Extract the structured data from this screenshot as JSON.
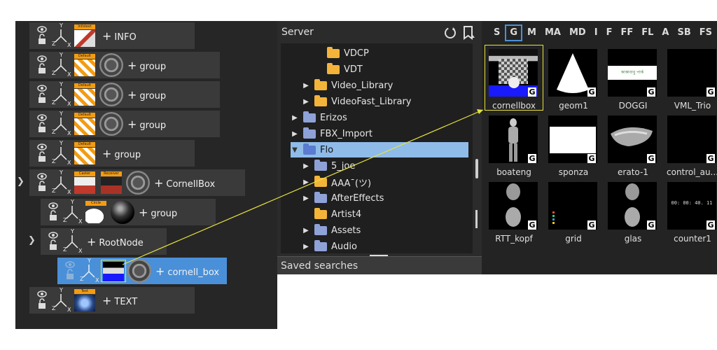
{
  "scene_tree": {
    "nodes": [
      {
        "label": "INFO",
        "tag": "Infotext"
      },
      {
        "label": "group",
        "tag": "Default"
      },
      {
        "label": "group",
        "tag": "Default"
      },
      {
        "label": "group",
        "tag": "Default"
      },
      {
        "label": "group",
        "tag": "Default"
      },
      {
        "label": "CornellBox",
        "tag_caster": "Caster",
        "tag_receiver": "Receiver"
      },
      {
        "label": "group",
        "tag": "Circle"
      },
      {
        "label": "RootNode"
      },
      {
        "label": "cornell_box"
      },
      {
        "label": "TEXT",
        "tag": "Text"
      }
    ],
    "axis": {
      "y": "Y",
      "z": "Z",
      "x": "X"
    }
  },
  "server": {
    "title": "Server",
    "folders": [
      {
        "label": "VDCP"
      },
      {
        "label": "VDT"
      },
      {
        "label": "Video_Library"
      },
      {
        "label": "VideoFast_Library"
      },
      {
        "label": "Erizos"
      },
      {
        "label": "FBX_Import"
      },
      {
        "label": "Flo"
      },
      {
        "label": "5_joe"
      },
      {
        "label": "AAA¯(ツ)"
      },
      {
        "label": "AfterEffects"
      },
      {
        "label": "Artist4"
      },
      {
        "label": "Assets"
      },
      {
        "label": "Audio"
      }
    ],
    "saved_searches": "Saved searches"
  },
  "assets": {
    "filters": [
      "S",
      "G",
      "M",
      "MA",
      "MD",
      "I",
      "F",
      "FF",
      "FL",
      "A",
      "SB",
      "FS"
    ],
    "active_filter": "G",
    "badge": "G",
    "items": [
      {
        "name": "cornellbox"
      },
      {
        "name": "geom1"
      },
      {
        "name": "DOGGI"
      },
      {
        "name": "VML_Trio"
      },
      {
        "name": "boateng"
      },
      {
        "name": "sponza"
      },
      {
        "name": "erato-1"
      },
      {
        "name": "control_au..."
      },
      {
        "name": "RTT_kopf"
      },
      {
        "name": "grid"
      },
      {
        "name": "glas"
      },
      {
        "name": "counter1"
      }
    ],
    "counter_text": "00: 00: 40. 11",
    "doggi_text": "কাকাবাবু পার্ক"
  },
  "colors": {
    "accent": "#4a90d9",
    "selection_frame": "#e6e23d",
    "folder_yellow": "#f4b43a",
    "folder_blue": "#8ea2d8"
  }
}
